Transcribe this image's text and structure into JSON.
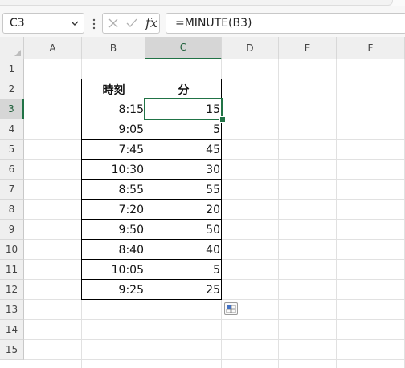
{
  "name_box": {
    "value": "C3"
  },
  "formula_bar": {
    "formula": "=MINUTE(B3)",
    "fx_label": "fx"
  },
  "columns": [
    "A",
    "B",
    "C",
    "D",
    "E",
    "F"
  ],
  "rows": [
    "1",
    "2",
    "3",
    "4",
    "5",
    "6",
    "7",
    "8",
    "9",
    "10",
    "11",
    "12",
    "13",
    "14",
    "15"
  ],
  "selected_cell": {
    "column": "C",
    "row": "3"
  },
  "table": {
    "headers": {
      "time": "時刻",
      "minute": "分"
    },
    "rows": [
      {
        "time": "8:15",
        "minute": "15"
      },
      {
        "time": "9:05",
        "minute": "5"
      },
      {
        "time": "7:45",
        "minute": "45"
      },
      {
        "time": "10:30",
        "minute": "30"
      },
      {
        "time": "8:55",
        "minute": "55"
      },
      {
        "time": "7:20",
        "minute": "20"
      },
      {
        "time": "9:50",
        "minute": "50"
      },
      {
        "time": "8:40",
        "minute": "40"
      },
      {
        "time": "10:05",
        "minute": "5"
      },
      {
        "time": "9:25",
        "minute": "25"
      }
    ]
  },
  "colors": {
    "accent": "#217346",
    "grid": "#e1e1e1",
    "header_bg": "#efefef"
  }
}
